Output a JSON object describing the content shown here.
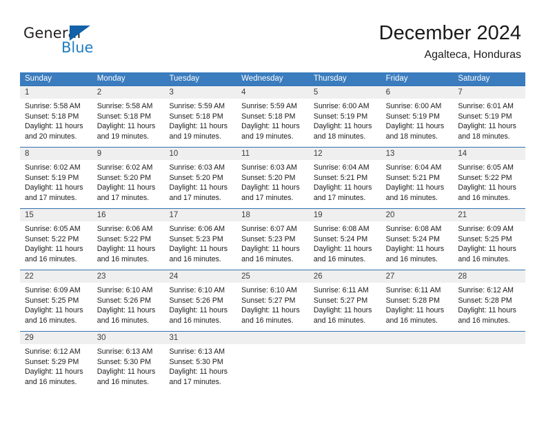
{
  "brand": {
    "name_top": "General",
    "name_bottom": "Blue",
    "accent_color": "#1361a8",
    "blue_text_color": "#1f7dc0"
  },
  "header": {
    "title": "December 2024",
    "subtitle": "Agalteca, Honduras"
  },
  "theme": {
    "header_bar_color": "#3a7cbe",
    "row_divider_color": "#2f6fb0",
    "daynum_band_color": "#efefef"
  },
  "weekdays": [
    "Sunday",
    "Monday",
    "Tuesday",
    "Wednesday",
    "Thursday",
    "Friday",
    "Saturday"
  ],
  "weeks": [
    [
      {
        "day": "1",
        "sunrise": "Sunrise: 5:58 AM",
        "sunset": "Sunset: 5:18 PM",
        "daylight1": "Daylight: 11 hours",
        "daylight2": "and 20 minutes."
      },
      {
        "day": "2",
        "sunrise": "Sunrise: 5:58 AM",
        "sunset": "Sunset: 5:18 PM",
        "daylight1": "Daylight: 11 hours",
        "daylight2": "and 19 minutes."
      },
      {
        "day": "3",
        "sunrise": "Sunrise: 5:59 AM",
        "sunset": "Sunset: 5:18 PM",
        "daylight1": "Daylight: 11 hours",
        "daylight2": "and 19 minutes."
      },
      {
        "day": "4",
        "sunrise": "Sunrise: 5:59 AM",
        "sunset": "Sunset: 5:18 PM",
        "daylight1": "Daylight: 11 hours",
        "daylight2": "and 19 minutes."
      },
      {
        "day": "5",
        "sunrise": "Sunrise: 6:00 AM",
        "sunset": "Sunset: 5:19 PM",
        "daylight1": "Daylight: 11 hours",
        "daylight2": "and 18 minutes."
      },
      {
        "day": "6",
        "sunrise": "Sunrise: 6:00 AM",
        "sunset": "Sunset: 5:19 PM",
        "daylight1": "Daylight: 11 hours",
        "daylight2": "and 18 minutes."
      },
      {
        "day": "7",
        "sunrise": "Sunrise: 6:01 AM",
        "sunset": "Sunset: 5:19 PM",
        "daylight1": "Daylight: 11 hours",
        "daylight2": "and 18 minutes."
      }
    ],
    [
      {
        "day": "8",
        "sunrise": "Sunrise: 6:02 AM",
        "sunset": "Sunset: 5:19 PM",
        "daylight1": "Daylight: 11 hours",
        "daylight2": "and 17 minutes."
      },
      {
        "day": "9",
        "sunrise": "Sunrise: 6:02 AM",
        "sunset": "Sunset: 5:20 PM",
        "daylight1": "Daylight: 11 hours",
        "daylight2": "and 17 minutes."
      },
      {
        "day": "10",
        "sunrise": "Sunrise: 6:03 AM",
        "sunset": "Sunset: 5:20 PM",
        "daylight1": "Daylight: 11 hours",
        "daylight2": "and 17 minutes."
      },
      {
        "day": "11",
        "sunrise": "Sunrise: 6:03 AM",
        "sunset": "Sunset: 5:20 PM",
        "daylight1": "Daylight: 11 hours",
        "daylight2": "and 17 minutes."
      },
      {
        "day": "12",
        "sunrise": "Sunrise: 6:04 AM",
        "sunset": "Sunset: 5:21 PM",
        "daylight1": "Daylight: 11 hours",
        "daylight2": "and 17 minutes."
      },
      {
        "day": "13",
        "sunrise": "Sunrise: 6:04 AM",
        "sunset": "Sunset: 5:21 PM",
        "daylight1": "Daylight: 11 hours",
        "daylight2": "and 16 minutes."
      },
      {
        "day": "14",
        "sunrise": "Sunrise: 6:05 AM",
        "sunset": "Sunset: 5:22 PM",
        "daylight1": "Daylight: 11 hours",
        "daylight2": "and 16 minutes."
      }
    ],
    [
      {
        "day": "15",
        "sunrise": "Sunrise: 6:05 AM",
        "sunset": "Sunset: 5:22 PM",
        "daylight1": "Daylight: 11 hours",
        "daylight2": "and 16 minutes."
      },
      {
        "day": "16",
        "sunrise": "Sunrise: 6:06 AM",
        "sunset": "Sunset: 5:22 PM",
        "daylight1": "Daylight: 11 hours",
        "daylight2": "and 16 minutes."
      },
      {
        "day": "17",
        "sunrise": "Sunrise: 6:06 AM",
        "sunset": "Sunset: 5:23 PM",
        "daylight1": "Daylight: 11 hours",
        "daylight2": "and 16 minutes."
      },
      {
        "day": "18",
        "sunrise": "Sunrise: 6:07 AM",
        "sunset": "Sunset: 5:23 PM",
        "daylight1": "Daylight: 11 hours",
        "daylight2": "and 16 minutes."
      },
      {
        "day": "19",
        "sunrise": "Sunrise: 6:08 AM",
        "sunset": "Sunset: 5:24 PM",
        "daylight1": "Daylight: 11 hours",
        "daylight2": "and 16 minutes."
      },
      {
        "day": "20",
        "sunrise": "Sunrise: 6:08 AM",
        "sunset": "Sunset: 5:24 PM",
        "daylight1": "Daylight: 11 hours",
        "daylight2": "and 16 minutes."
      },
      {
        "day": "21",
        "sunrise": "Sunrise: 6:09 AM",
        "sunset": "Sunset: 5:25 PM",
        "daylight1": "Daylight: 11 hours",
        "daylight2": "and 16 minutes."
      }
    ],
    [
      {
        "day": "22",
        "sunrise": "Sunrise: 6:09 AM",
        "sunset": "Sunset: 5:25 PM",
        "daylight1": "Daylight: 11 hours",
        "daylight2": "and 16 minutes."
      },
      {
        "day": "23",
        "sunrise": "Sunrise: 6:10 AM",
        "sunset": "Sunset: 5:26 PM",
        "daylight1": "Daylight: 11 hours",
        "daylight2": "and 16 minutes."
      },
      {
        "day": "24",
        "sunrise": "Sunrise: 6:10 AM",
        "sunset": "Sunset: 5:26 PM",
        "daylight1": "Daylight: 11 hours",
        "daylight2": "and 16 minutes."
      },
      {
        "day": "25",
        "sunrise": "Sunrise: 6:10 AM",
        "sunset": "Sunset: 5:27 PM",
        "daylight1": "Daylight: 11 hours",
        "daylight2": "and 16 minutes."
      },
      {
        "day": "26",
        "sunrise": "Sunrise: 6:11 AM",
        "sunset": "Sunset: 5:27 PM",
        "daylight1": "Daylight: 11 hours",
        "daylight2": "and 16 minutes."
      },
      {
        "day": "27",
        "sunrise": "Sunrise: 6:11 AM",
        "sunset": "Sunset: 5:28 PM",
        "daylight1": "Daylight: 11 hours",
        "daylight2": "and 16 minutes."
      },
      {
        "day": "28",
        "sunrise": "Sunrise: 6:12 AM",
        "sunset": "Sunset: 5:28 PM",
        "daylight1": "Daylight: 11 hours",
        "daylight2": "and 16 minutes."
      }
    ],
    [
      {
        "day": "29",
        "sunrise": "Sunrise: 6:12 AM",
        "sunset": "Sunset: 5:29 PM",
        "daylight1": "Daylight: 11 hours",
        "daylight2": "and 16 minutes."
      },
      {
        "day": "30",
        "sunrise": "Sunrise: 6:13 AM",
        "sunset": "Sunset: 5:30 PM",
        "daylight1": "Daylight: 11 hours",
        "daylight2": "and 16 minutes."
      },
      {
        "day": "31",
        "sunrise": "Sunrise: 6:13 AM",
        "sunset": "Sunset: 5:30 PM",
        "daylight1": "Daylight: 11 hours",
        "daylight2": "and 17 minutes."
      },
      {
        "day": "",
        "sunrise": "",
        "sunset": "",
        "daylight1": "",
        "daylight2": ""
      },
      {
        "day": "",
        "sunrise": "",
        "sunset": "",
        "daylight1": "",
        "daylight2": ""
      },
      {
        "day": "",
        "sunrise": "",
        "sunset": "",
        "daylight1": "",
        "daylight2": ""
      },
      {
        "day": "",
        "sunrise": "",
        "sunset": "",
        "daylight1": "",
        "daylight2": ""
      }
    ]
  ]
}
